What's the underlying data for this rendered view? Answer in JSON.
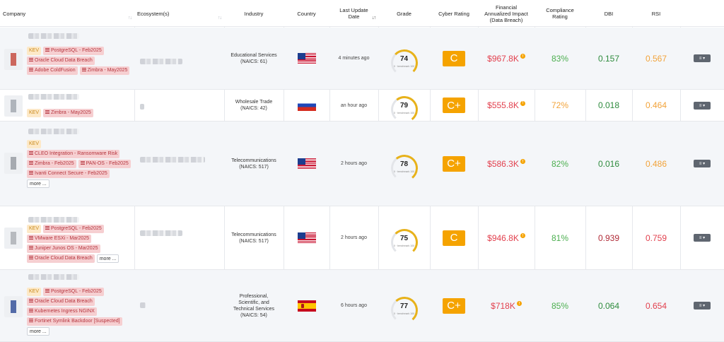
{
  "header": {
    "company": "Company",
    "ecosystems": "Ecosystem(s)",
    "industry": "Industry",
    "country": "Country",
    "last_update": "Last Update Date",
    "grade": "Grade",
    "cyber_rating": "Cyber Rating",
    "financial": "Financial Annualized Impact (Data Breach)",
    "compliance": "Compliance Rating",
    "dbi": "DBI",
    "rsi": "RSI"
  },
  "gauge_scale": {
    "min": "0",
    "label": "benchmark",
    "max": "100"
  },
  "more_label": "more ...",
  "actions_label": "≡ ▾",
  "info_glyph": "!",
  "colors": {
    "red": "#e2404e",
    "green": "#4caf50",
    "dark_green": "#2e8b3d",
    "orange": "#f2a33a",
    "dark_red": "#b02a37",
    "grade": "#f5a300"
  },
  "rows": [
    {
      "tags": [
        "KEV",
        "PostgreSQL - Feb2025",
        "Oracle Cloud Data Breach",
        "Adobe ColdFusion",
        "Zimbra - May2025"
      ],
      "industry": "Educational Services (NAICS: 61)",
      "country": "us",
      "updated": "4 minutes ago",
      "score": "74",
      "score_value": 74,
      "rating": "C",
      "impact": "$967.8K",
      "compliance": "83%",
      "dbi": "0.157",
      "rsi": "0.567"
    },
    {
      "tags": [
        "KEV",
        "Zimbra - May2025"
      ],
      "industry": "Wholesale Trade (NAICS: 42)",
      "country": "ru",
      "updated": "an hour ago",
      "score": "79",
      "score_value": 79,
      "rating": "C+",
      "impact": "$555.8K",
      "compliance": "72%",
      "dbi": "0.018",
      "rsi": "0.464"
    },
    {
      "tags": [
        "KEV",
        "CLEO Integration - Ransomware Risk",
        "Zimbra - Feb2025",
        "PAN-OS - Feb2025",
        "Ivanti Connect Secure - Feb2025"
      ],
      "industry": "Telecommunications (NAICS: 517)",
      "country": "us",
      "updated": "2 hours ago",
      "score": "78",
      "score_value": 78,
      "rating": "C+",
      "impact": "$586.3K",
      "compliance": "82%",
      "dbi": "0.016",
      "rsi": "0.486"
    },
    {
      "tags": [
        "KEV",
        "PostgreSQL - Feb2025",
        "VMware ESXi - Mar2025",
        "Juniper Junos OS - Mar2025",
        "Oracle Cloud Data Breach"
      ],
      "industry": "Telecommunications (NAICS: 517)",
      "country": "us",
      "updated": "2 hours ago",
      "score": "75",
      "score_value": 75,
      "rating": "C",
      "impact": "$946.8K",
      "compliance": "81%",
      "dbi": "0.939",
      "rsi": "0.759"
    },
    {
      "tags": [
        "KEV",
        "PostgreSQL - Feb2025",
        "Oracle Cloud Data Breach",
        "Kubernetes Ingress NGINX",
        "Fortinet Symlink Backdoor [Suspected]"
      ],
      "industry": "Professional, Scientific, and Technical Services (NAICS: 54)",
      "country": "es",
      "updated": "6 hours ago",
      "score": "77",
      "score_value": 77,
      "rating": "C+",
      "impact": "$718K",
      "compliance": "85%",
      "dbi": "0.064",
      "rsi": "0.654"
    }
  ]
}
